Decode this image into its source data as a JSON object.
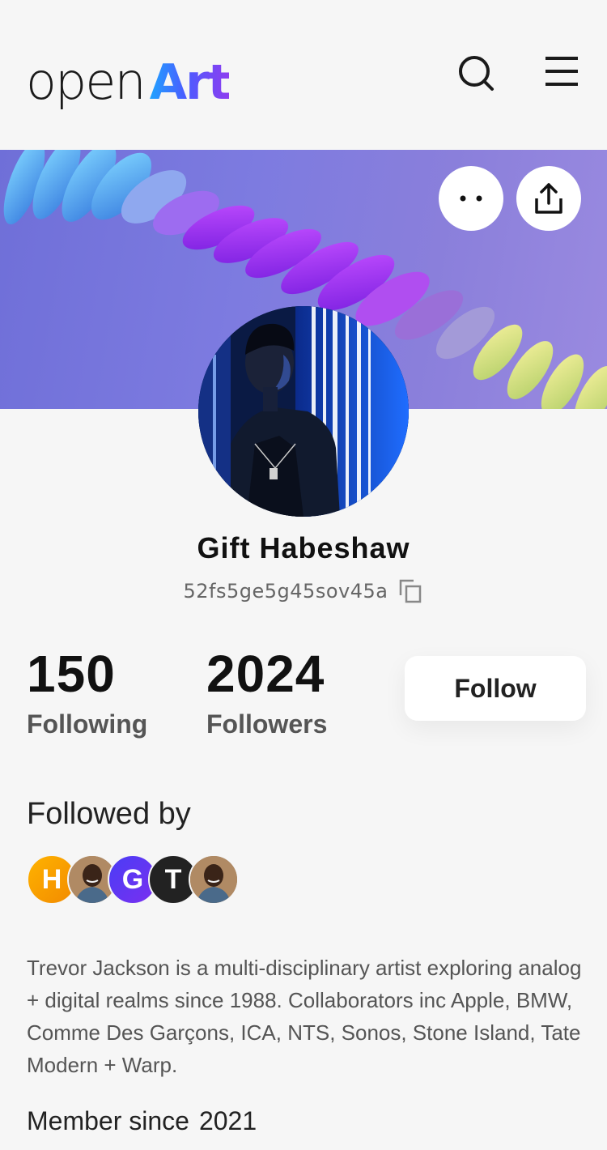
{
  "header": {
    "logo_open": "open",
    "logo_art": "Art",
    "search_icon": "search-icon",
    "menu_icon": "hamburger-menu-icon"
  },
  "cover": {
    "more_icon": "more-dots-icon",
    "share_icon": "share-icon"
  },
  "profile": {
    "name": "Gift Habeshaw",
    "address": "52fs5ge5g45sov45a",
    "copy_icon": "copy-icon"
  },
  "stats": {
    "following_count": "150",
    "following_label": "Following",
    "followers_count": "2024",
    "followers_label": "Followers",
    "follow_button": "Follow"
  },
  "followed_by": {
    "title": "Followed by",
    "avatars": [
      {
        "initial": "H",
        "color": "#f5a623"
      },
      {
        "initial": "",
        "color": "#8a6a4a"
      },
      {
        "initial": "G",
        "color": "#5b3df0"
      },
      {
        "initial": "T",
        "color": "#222222"
      },
      {
        "initial": "",
        "color": "#8a6a4a"
      }
    ]
  },
  "bio": "Trevor Jackson is a multi-disciplinary artist exploring analog + digital realms since 1988. Collaborators inc Apple, BMW, Comme Des Garçons, ICA, NTS, Sonos, Stone Island, Tate Modern + Warp.",
  "member": {
    "label": "Member since",
    "year": "2021"
  },
  "colors": {
    "accent_start": "#1fa3ff",
    "accent_end": "#8e3df0",
    "background": "#f6f6f6"
  }
}
